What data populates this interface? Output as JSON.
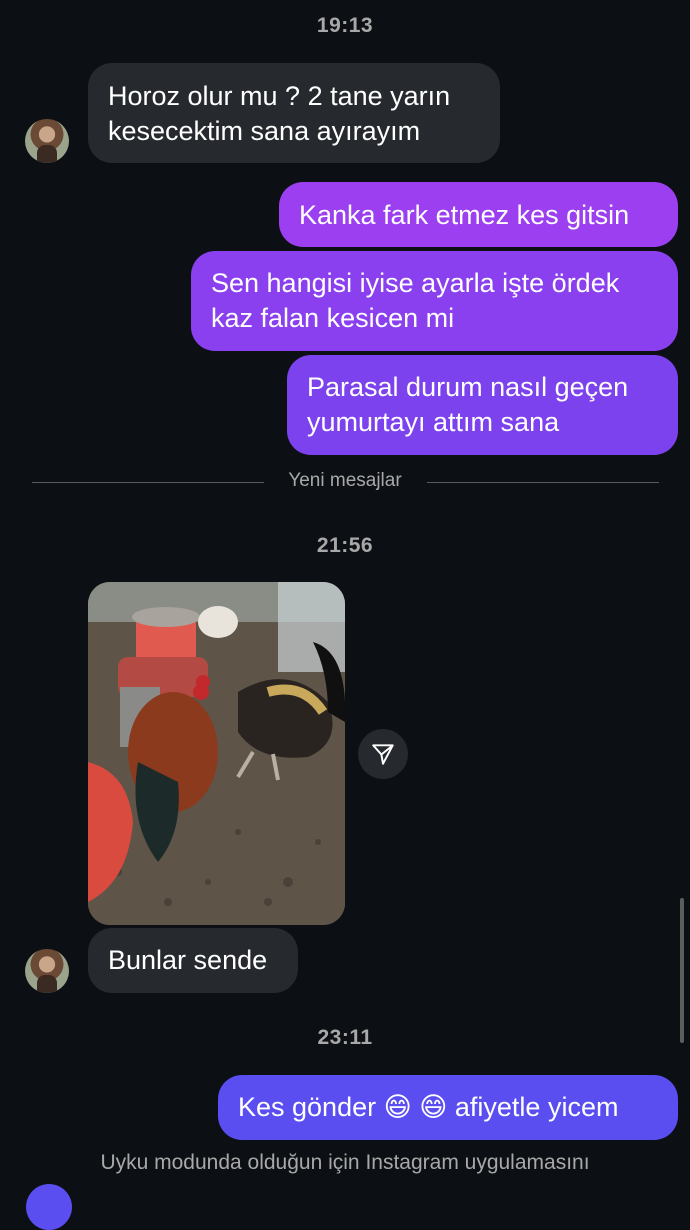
{
  "timestamps": [
    "19:13",
    "21:56",
    "23:11"
  ],
  "messages": {
    "m1": "Horoz olur mu ? 2 tane yarın kesecektim sana ayırayım",
    "m2": "Kanka fark etmez kes gitsin",
    "m3": "Sen hangisi iyise ayarla işte ördek kaz falan kesicen mi",
    "m4": "Parasal durum nasıl geçen yumurtayı attım sana",
    "m5": "Bunlar sende",
    "m6": "Kes gönder 😄 😄  afiyetle yicem"
  },
  "divider": {
    "label": "Yeni mesajlar"
  },
  "footer": {
    "text": "Uyku modunda olduğun için Instagram uygulamasını"
  },
  "icons": {
    "share": "share-arrow-icon",
    "avatar": "contact-avatar"
  },
  "colors": {
    "background": "#0c1014",
    "incoming_bubble": "#262a2f",
    "outgoing_purple": "#9b3ff0",
    "outgoing_indigo": "#5a4ef0",
    "muted_text": "#a8a8a8"
  }
}
